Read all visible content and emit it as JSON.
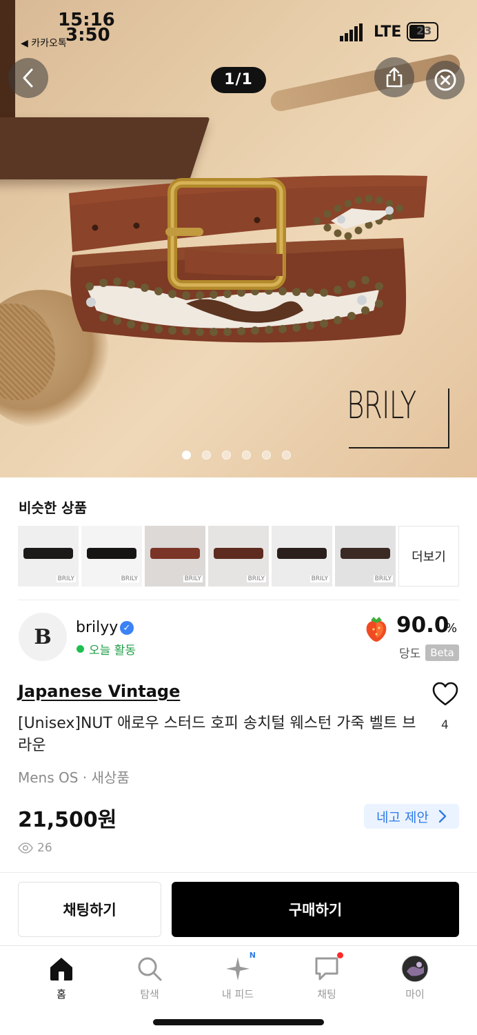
{
  "status_bar": {
    "time_top": "15:16",
    "time_bottom": "3:50",
    "back_app": "◀ 카카오톡",
    "network": "LTE",
    "battery": "23"
  },
  "gallery": {
    "counter": "1/1",
    "brand_watermark": "BRILY",
    "page_dots": 6,
    "active_dot": 0
  },
  "similar": {
    "title": "비슷한 상품",
    "more_label": "더보기",
    "thumb_tag": "BRILY",
    "items": [
      {
        "belt_color": "#1c1a18",
        "bg": "#efefef"
      },
      {
        "belt_color": "#161514",
        "bg": "#f4f4f4"
      },
      {
        "belt_color": "#7a3526",
        "bg": "#dcd9d6"
      },
      {
        "belt_color": "#5d2b1f",
        "bg": "#e6e4e2"
      },
      {
        "belt_color": "#2a1f1b",
        "bg": "#ececec"
      },
      {
        "belt_color": "#3b2a24",
        "bg": "#e2e2e2"
      }
    ]
  },
  "seller": {
    "avatar_letter": "B",
    "name": "brilyy",
    "activity": "오늘 활동",
    "score": "90.0",
    "score_unit": "%",
    "score_label": "당도",
    "beta": "Beta"
  },
  "product": {
    "brand": "Japanese Vintage",
    "title": "[Unisex]NUT 애로우 스터드 호피 송치털 웨스턴 가죽 벨트 브라운",
    "meta": "Mens OS · 새상품",
    "likes": "4",
    "price": "21,500원",
    "offer_label": "네고 제안",
    "views": "26"
  },
  "actions": {
    "chat": "채팅하기",
    "buy": "구매하기"
  },
  "nav": {
    "items": [
      {
        "label": "홈",
        "icon": "home-icon"
      },
      {
        "label": "탐색",
        "icon": "search-icon"
      },
      {
        "label": "내 피드",
        "icon": "sparkle-icon",
        "badge": "N"
      },
      {
        "label": "채팅",
        "icon": "chat-icon"
      },
      {
        "label": "마이",
        "icon": "profile-avatar"
      }
    ]
  },
  "colors": {
    "accent_blue": "#2f7ae5",
    "active_green": "#1fbf4f",
    "buy_black": "#000000"
  }
}
